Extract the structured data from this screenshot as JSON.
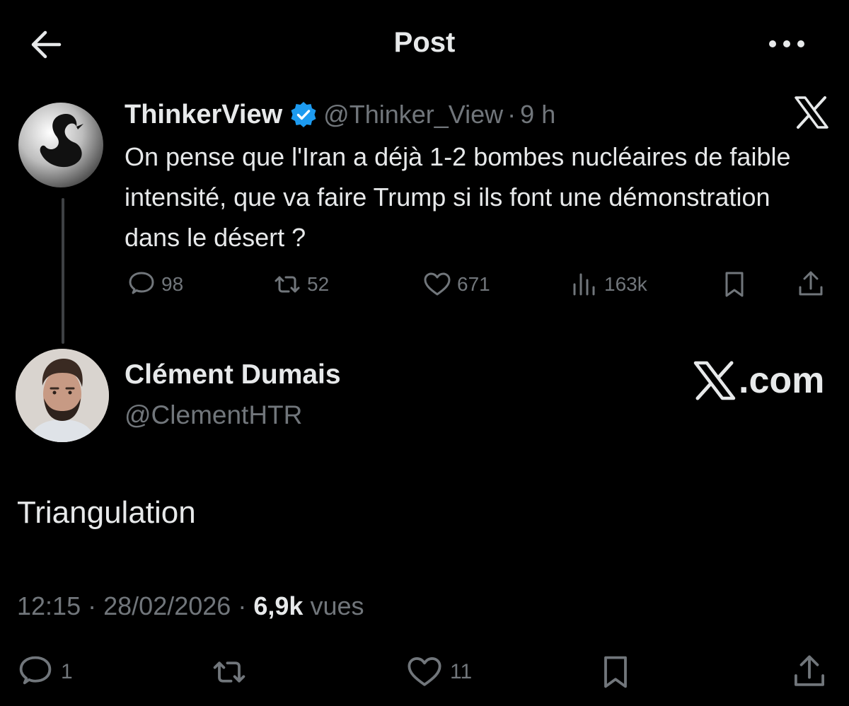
{
  "header": {
    "title": "Post",
    "back_icon": "arrow-left-icon",
    "more_icon": "more-horizontal-icon"
  },
  "quoted_tweet": {
    "display_name": "ThinkerView",
    "verified": true,
    "handle": "@Thinker_View",
    "separator": "·",
    "time": "9 h",
    "text": "On pense que l'Iran a déjà 1-2 bombes nucléaires de faible intensité, que va faire Trump si ils font une démonstration dans le désert ?",
    "metrics": {
      "replies": "98",
      "reposts": "52",
      "likes": "671",
      "views": "163k"
    }
  },
  "main_tweet": {
    "display_name": "Clément Dumais",
    "handle": "@ClementHTR",
    "brand_text": ".com",
    "text": "Triangulation",
    "time": "12:15",
    "date": "28/02/2026",
    "separator": "·",
    "views_count": "6,9k",
    "views_label": "vues",
    "metrics": {
      "replies": "1",
      "likes": "11"
    }
  },
  "colors": {
    "background": "#000000",
    "text_primary": "#e7e9ea",
    "text_secondary": "#71767b",
    "verified_blue": "#1d9bf0"
  }
}
